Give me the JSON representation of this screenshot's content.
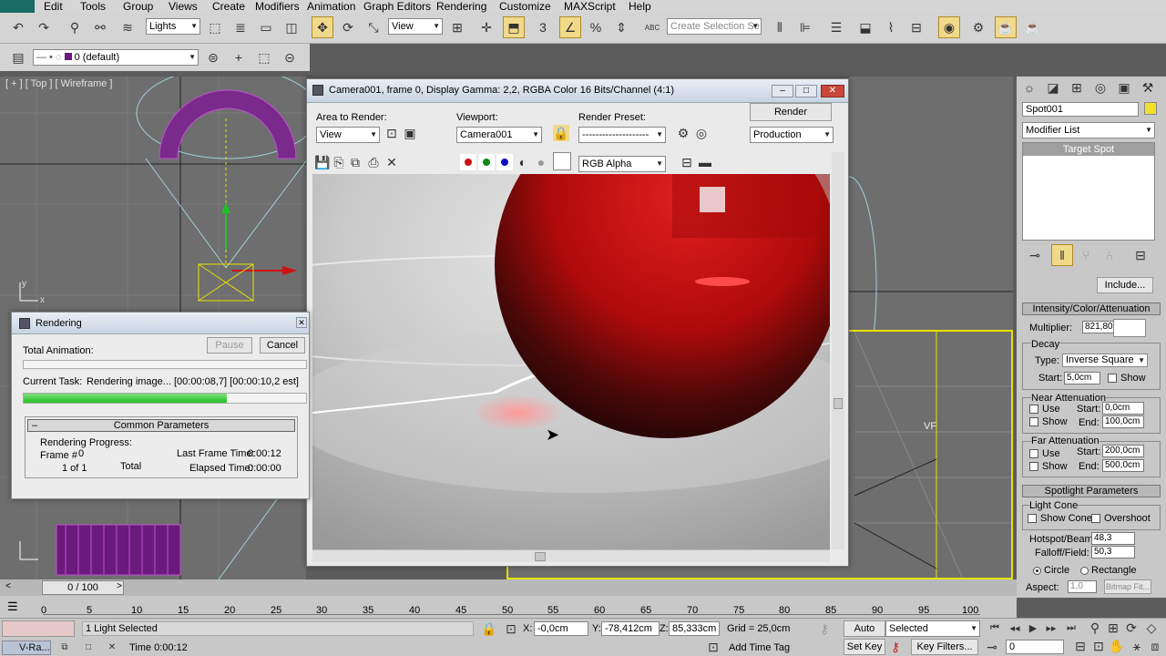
{
  "menu": [
    "Edit",
    "Tools",
    "Group",
    "Views",
    "Create",
    "Modifiers",
    "Animation",
    "Graph Editors",
    "Rendering",
    "Customize",
    "MAXScript",
    "Help"
  ],
  "toolbar": {
    "selection_filter": "Lights",
    "ref_coord": "View",
    "named_selection_placeholder": "Create Selection Se",
    "layer": "0 (default)",
    "snap_label": "3",
    "abc_label": "ABC"
  },
  "viewports": {
    "top_label": "[ + ] [ Top ] [ Wireframe ]",
    "corner_label": "VF",
    "axis_y": "y",
    "axis_x": "x"
  },
  "frame_window": {
    "title": "Camera001, frame 0, Display Gamma: 2,2, RGBA Color 16 Bits/Channel (4:1)",
    "area_label": "Area to Render:",
    "area_value": "View",
    "viewport_label": "Viewport:",
    "viewport_value": "Camera001",
    "preset_label": "Render Preset:",
    "preset_value": "--------------------",
    "render_button": "Render",
    "production_value": "Production",
    "channel_value": "RGB Alpha"
  },
  "rendering_dialog": {
    "title": "Rendering",
    "total_animation": "Total Animation:",
    "pause": "Pause",
    "cancel": "Cancel",
    "current_task_label": "Current Task:",
    "current_task_value": "Rendering image... [00:00:08,7] [00:00:10,2 est]",
    "progress": 0.72,
    "rollout": "Common Parameters",
    "rendering_progress": "Rendering Progress:",
    "frame_label": "Frame #",
    "frame_value": "0",
    "of_label": "1 of 1",
    "total_label": "Total",
    "last_frame_label": "Last Frame Time:",
    "last_frame_value": "0:00:12",
    "elapsed_label": "Elapsed Time:",
    "elapsed_value": "0:00:00"
  },
  "command_panel": {
    "object_name": "Spot001",
    "modifier_list": "Modifier List",
    "stack_item": "Target Spot",
    "include_button": "Include...",
    "intensity_header": "Intensity/Color/Attenuation",
    "multiplier_label": "Multiplier:",
    "multiplier_value": "821,80",
    "decay_label": "Decay",
    "type_label": "Type:",
    "type_value": "Inverse Square",
    "start_label": "Start:",
    "start_value": "5,0cm",
    "show_label": "Show",
    "near_label": "Near Attenuation",
    "use_label": "Use",
    "near_start_label": "Start:",
    "near_start_value": "0,0cm",
    "near_show_label": "Show",
    "near_end_label": "End:",
    "near_end_value": "100,0cm",
    "far_label": "Far Attenuation",
    "far_use_label": "Use",
    "far_start_label": "Start:",
    "far_start_value": "200,0cm",
    "far_show_label": "Show",
    "far_end_label": "End:",
    "far_end_value": "500,0cm",
    "spot_header": "Spotlight Parameters",
    "light_cone_label": "Light Cone",
    "show_cone_label": "Show Cone",
    "overshoot_label": "Overshoot",
    "hotspot_label": "Hotspot/Beam:",
    "hotspot_value": "48,3",
    "falloff_label": "Falloff/Field:",
    "falloff_value": "50,3",
    "circle_label": "Circle",
    "rectangle_label": "Rectangle",
    "aspect_label": "Aspect:",
    "aspect_value": "1,0",
    "bitmap_fit": "Bitmap Fit..."
  },
  "timeline": {
    "slider_label": "0 / 100",
    "ticks": [
      "0",
      "5",
      "10",
      "15",
      "20",
      "25",
      "30",
      "35",
      "40",
      "45",
      "50",
      "55",
      "60",
      "65",
      "70",
      "75",
      "80",
      "85",
      "90",
      "95",
      "100"
    ]
  },
  "status": {
    "selected": "1 Light Selected",
    "x_label": "X:",
    "x_value": "-0,0cm",
    "y_label": "Y:",
    "y_value": "-78,412cm",
    "z_label": "Z:",
    "z_value": "85,333cm",
    "grid": "Grid = 25,0cm",
    "time": "Time  0:00:12",
    "add_time_tag": "Add Time Tag",
    "auto_key": "Auto Key",
    "set_key": "Set Key",
    "key_mode": "Selected",
    "key_filters": "Key Filters...",
    "frame_field": "0",
    "taskbar_item": "V-Ra..."
  }
}
